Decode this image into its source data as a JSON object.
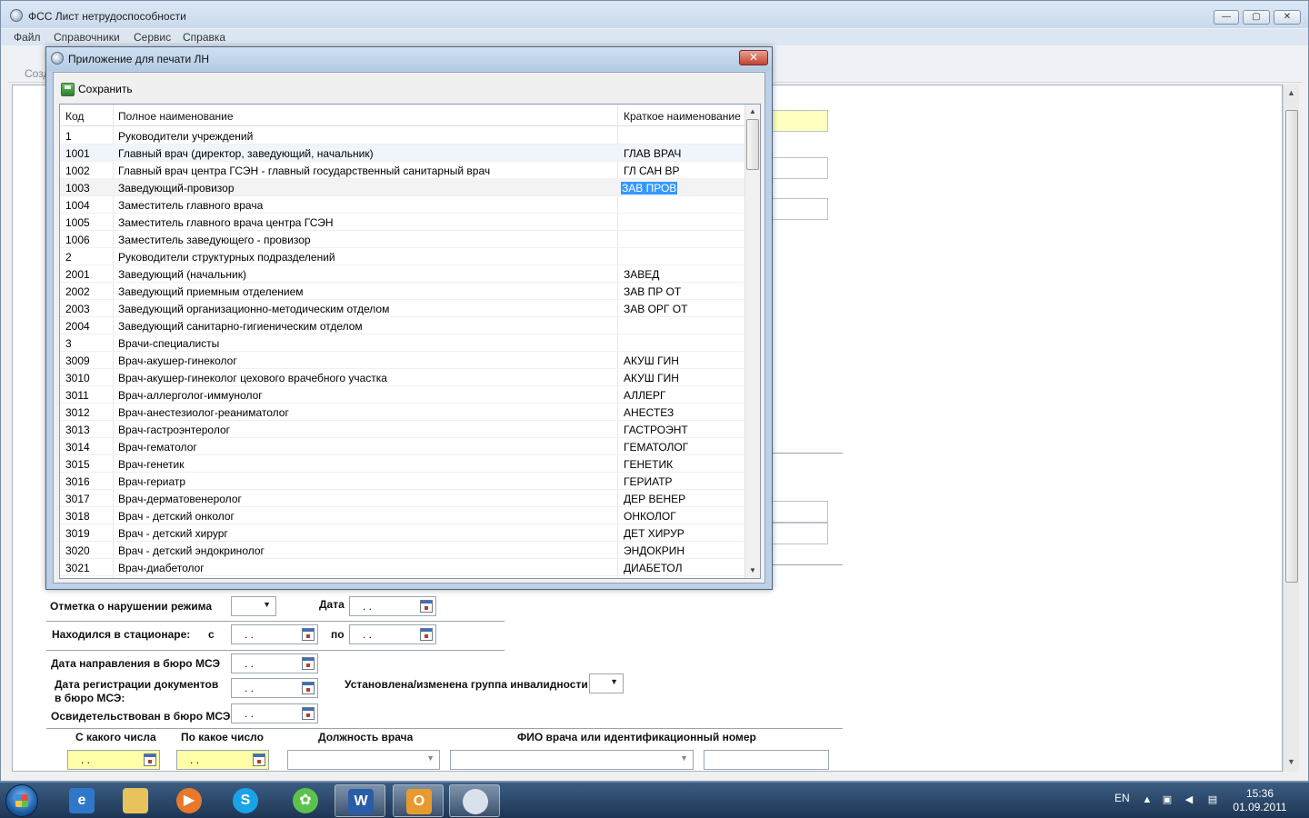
{
  "main_window": {
    "title": "ФСС Лист нетрудоспособности",
    "minimize_glyph": "—",
    "maximize_glyph": "▢",
    "close_glyph": "✕",
    "menu": [
      "Файл",
      "Справочники",
      "Сервис",
      "Справка"
    ],
    "toolbar_partial": "Созд"
  },
  "dialog": {
    "title": "Приложение для печати ЛН",
    "close_glyph": "✕",
    "save_label": "Сохранить",
    "columns": [
      "Код",
      "Полное наименование",
      "Краткое наименование"
    ],
    "rows": [
      {
        "code": "1",
        "full": "Руководители учреждений",
        "short": ""
      },
      {
        "code": "1001",
        "full": "Главный врач (директор, заведующий, начальник)",
        "short": "ГЛАВ ВРАЧ"
      },
      {
        "code": "1002",
        "full": "Главный врач центра ГСЭН - главный государственный санитарный врач",
        "short": "ГЛ САН ВР"
      },
      {
        "code": "1003",
        "full": "Заведующий-провизор",
        "short": "ЗАВ ПРОВ"
      },
      {
        "code": "1004",
        "full": "Заместитель главного врача",
        "short": ""
      },
      {
        "code": "1005",
        "full": "Заместитель главного врача центра ГСЭН",
        "short": ""
      },
      {
        "code": "1006",
        "full": "Заместитель заведующего - провизор",
        "short": ""
      },
      {
        "code": "2",
        "full": "Руководители структурных подразделений",
        "short": ""
      },
      {
        "code": "2001",
        "full": "Заведующий (начальник)",
        "short": "ЗАВЕД"
      },
      {
        "code": "2002",
        "full": "Заведующий приемным отделением",
        "short": "ЗАВ ПР ОТ"
      },
      {
        "code": "2003",
        "full": "Заведующий организационно-методическим отделом",
        "short": "ЗАВ ОРГ ОТ"
      },
      {
        "code": "2004",
        "full": "Заведующий санитарно-гигиеническим отделом",
        "short": ""
      },
      {
        "code": "3",
        "full": "Врачи-специалисты",
        "short": ""
      },
      {
        "code": "3009",
        "full": "Врач-акушер-гинеколог",
        "short": "АКУШ ГИН"
      },
      {
        "code": "3010",
        "full": "Врач-акушер-гинеколог цехового врачебного участка",
        "short": "АКУШ ГИН"
      },
      {
        "code": "3011",
        "full": "Врач-аллерголог-иммунолог",
        "short": "АЛЛЕРГ"
      },
      {
        "code": "3012",
        "full": "Врач-анестезиолог-реаниматолог",
        "short": "АНЕСТЕЗ"
      },
      {
        "code": "3013",
        "full": "Врач-гастроэнтеролог",
        "short": "ГАСТРОЭНТ"
      },
      {
        "code": "3014",
        "full": "Врач-гематолог",
        "short": "ГЕМАТОЛОГ"
      },
      {
        "code": "3015",
        "full": "Врач-генетик",
        "short": "ГЕНЕТИК"
      },
      {
        "code": "3016",
        "full": "Врач-гериатр",
        "short": "ГЕРИАТР"
      },
      {
        "code": "3017",
        "full": "Врач-дерматовенеролог",
        "short": "ДЕР ВЕНЕР"
      },
      {
        "code": "3018",
        "full": "Врач - детский онколог",
        "short": "ОНКОЛОГ"
      },
      {
        "code": "3019",
        "full": "Врач - детский хирург",
        "short": "ДЕТ ХИРУР"
      },
      {
        "code": "3020",
        "full": "Врач - детский эндокринолог",
        "short": "ЭНДОКРИН"
      },
      {
        "code": "3021",
        "full": "Врач-диабетолог",
        "short": "ДИАБЕТОЛ"
      }
    ]
  },
  "form": {
    "regime_violation_label": "Отметка о нарушении режима",
    "date_label": "Дата",
    "hospital_label": "Находился в стационаре:",
    "from_label": "с",
    "to_label": "по",
    "mse_direction_label": "Дата направления в бюро МСЭ",
    "mse_registration_label_1": "Дата регистрации документов",
    "mse_registration_label_2": "в бюро МСЭ:",
    "mse_examined_label": "Освидетельствован в бюро МСЭ:",
    "disability_group_label": "Установлена/изменена группа инвалидности",
    "col_from_date": "С какого числа",
    "col_to_date": "По какое число",
    "col_doctor_position": "Должность врача",
    "col_doctor_name": "ФИО врача или идентификационный номер",
    "empty_date": ". ."
  },
  "taskbar": {
    "lang": "EN",
    "time": "15:36",
    "date": "01.09.2011",
    "apps": [
      "internet-explorer",
      "file-explorer",
      "media-player",
      "skype",
      "icq",
      "word",
      "outlook",
      "fss-app"
    ]
  }
}
